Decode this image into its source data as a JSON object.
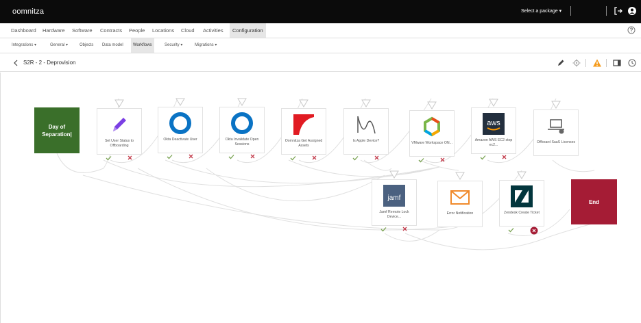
{
  "app": {
    "brand": "oomnitza",
    "package_select": "Select a package ▾"
  },
  "nav_primary": [
    {
      "label": "Dashboard"
    },
    {
      "label": "Hardware"
    },
    {
      "label": "Software"
    },
    {
      "label": "Contracts"
    },
    {
      "label": "People"
    },
    {
      "label": "Locations"
    },
    {
      "label": "Cloud"
    },
    {
      "label": "Activities"
    },
    {
      "label": "Configuration"
    }
  ],
  "nav_secondary": [
    {
      "label": "Integrations ▾"
    },
    {
      "label": "General ▾"
    },
    {
      "label": "Objects"
    },
    {
      "label": "Data model"
    },
    {
      "label": "Workflows"
    },
    {
      "label": "Security ▾"
    },
    {
      "label": "Migrations ▾"
    }
  ],
  "workflow": {
    "title": "S2R - 2 - Deprovision"
  },
  "nodes": {
    "start": {
      "label": "Day of Separation|"
    },
    "end": {
      "label": "End"
    },
    "set_user_status": {
      "label": "Set User Status to Offboarding"
    },
    "okta_deactivate": {
      "label": "Okta Deactivate User"
    },
    "okta_invalidate": {
      "label": "Okta Invalidate Open Sessions"
    },
    "oomnitza_assets": {
      "label": "Oomnitza Get Assigned Assets"
    },
    "is_apple": {
      "label": "Is Apple Device?"
    },
    "vmware": {
      "label": "VMware Workspace ON..."
    },
    "aws": {
      "label": "Amazon AWS EC2 stop ec2..."
    },
    "offboard_saas": {
      "label": "Offboard SaaS Licenses"
    },
    "jamf": {
      "label": "Jamf Remote Lock Device..."
    },
    "error_notify": {
      "label": "Error Notification"
    },
    "zendesk": {
      "label": "Zendesk Create Ticket"
    }
  },
  "icons": {
    "logout": "logout-icon",
    "user": "user-icon",
    "help": "help-icon",
    "edit": "pencil-icon",
    "settings": "gear-icon",
    "warning": "warning-icon",
    "panel": "panel-icon",
    "history": "history-icon"
  },
  "colors": {
    "start": "#3a6f2a",
    "end": "#a51c35",
    "okta": "#0a73c4",
    "pencil": "#7b3fe4",
    "oomnitza": "#e11b22",
    "email": "#f0892a",
    "zendesk": "#03363d",
    "jamf": "#4b6180",
    "aws": "#232f3e",
    "warning": "#f59b1c"
  }
}
